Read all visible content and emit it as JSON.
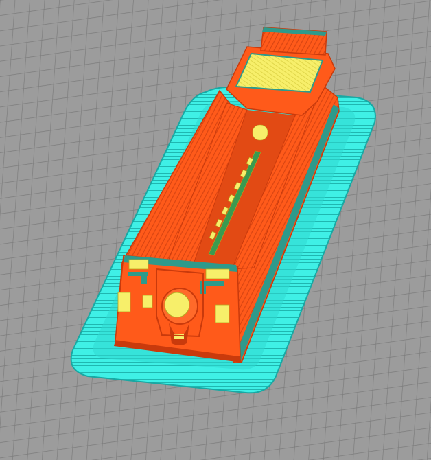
{
  "viewport": {
    "view": "3d-layer-preview",
    "grid_visible": true
  },
  "colors": {
    "bed": "#9c9c9c",
    "bed_grid": "#7b7b7b",
    "skirt_brim": "#3ff0e6",
    "skirt_brim_dark": "#18a8a3",
    "perimeter": "#ff5a1a",
    "perimeter_dark": "#c93a0c",
    "infill_top": "#f7ef6a",
    "support_teal": "#2e9a8b",
    "green_edge": "#36c04a"
  },
  "model": {
    "name": "",
    "features": [
      "brim",
      "outer-walls",
      "inner-walls",
      "top-skin",
      "slot-channel",
      "end-cap-with-hole"
    ]
  }
}
